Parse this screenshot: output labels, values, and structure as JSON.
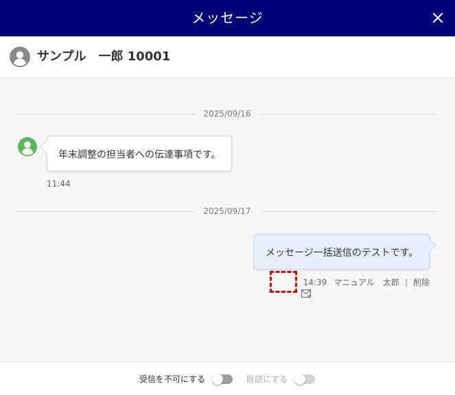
{
  "window": {
    "title": "メッセージ",
    "close_icon": "close-icon",
    "header_color": "#000078"
  },
  "user": {
    "name": "サンプル　一郎 10001",
    "avatar_icon": "person-avatar-icon"
  },
  "messages": [
    {
      "date": "2025/09/16",
      "direction": "incoming",
      "text": "年末調整の担当者への伝達事項です。",
      "time": "11:44",
      "avatar_color": "#5cb85c"
    },
    {
      "date": "2025/09/17",
      "direction": "outgoing",
      "text": "メッセージ一括送信のテストです。",
      "time": "14:39",
      "sender": "マニュアル　太郎",
      "separator": "|",
      "delete_label": "削除",
      "status_icon": "envelope-read-icon"
    }
  ],
  "footer": {
    "reject_label": "受信を不可にする",
    "reject_on": false,
    "read_label": "既読にする",
    "read_on": false,
    "read_disabled": true
  },
  "highlight_color": "#e60000"
}
